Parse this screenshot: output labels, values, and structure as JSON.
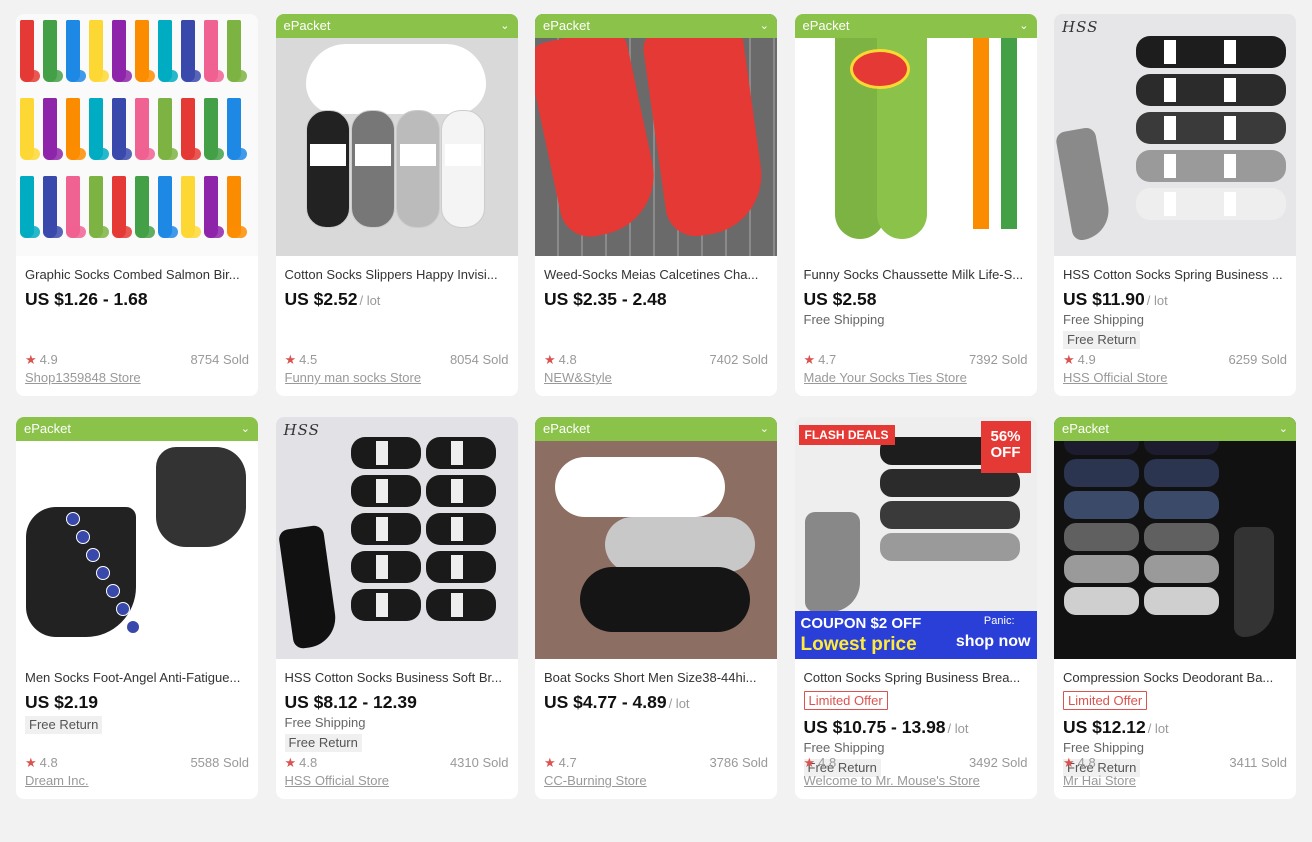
{
  "products": [
    {
      "title": "Graphic Socks Combed Salmon Bir...",
      "price": "US $1.26 - 1.68",
      "per": "",
      "shipping": "",
      "free_return": "",
      "limited": "",
      "rating": "4.9",
      "sold": "8754 Sold",
      "store": "Shop1359848 Store",
      "badge": "",
      "img_theme": "colorful"
    },
    {
      "title": "Cotton Socks Slippers Happy Invisi...",
      "price": "US $2.52",
      "per": "/ lot",
      "shipping": "",
      "free_return": "",
      "limited": "",
      "rating": "4.5",
      "sold": "8054 Sold",
      "store": "Funny man socks Store",
      "badge": "ePacket",
      "img_theme": "noshow"
    },
    {
      "title": "Weed-Socks Meias Calcetines Cha...",
      "price": "US $2.35 - 2.48",
      "per": "",
      "shipping": "",
      "free_return": "",
      "limited": "",
      "rating": "4.8",
      "sold": "7402 Sold",
      "store": "NEW&Style",
      "badge": "ePacket",
      "img_theme": "red"
    },
    {
      "title": "Funny Socks Chaussette Milk Life-S...",
      "price": "US $2.58",
      "per": "",
      "shipping": "Free Shipping",
      "free_return": "",
      "limited": "",
      "rating": "4.7",
      "sold": "7392 Sold",
      "store": "Made Your Socks Ties Store",
      "badge": "ePacket",
      "img_theme": "chips"
    },
    {
      "title": "HSS Cotton Socks Spring Business ...",
      "price": "US $11.90",
      "per": "/ lot",
      "shipping": "Free Shipping",
      "free_return": "Free Return",
      "limited": "",
      "rating": "4.9",
      "sold": "6259 Sold",
      "store": "HSS Official Store",
      "badge": "HSS",
      "img_theme": "boxgray"
    },
    {
      "title": "Men Socks Foot-Angel Anti-Fatigue...",
      "price": "US $2.19",
      "per": "",
      "shipping": "",
      "free_return": "Free Return",
      "limited": "",
      "rating": "4.8",
      "sold": "5588 Sold",
      "store": "Dream Inc.",
      "badge": "ePacket",
      "img_theme": "ankle"
    },
    {
      "title": "HSS Cotton Socks Business Soft Br...",
      "price": "US $8.12 - 12.39",
      "per": "",
      "shipping": "Free Shipping",
      "free_return": "Free Return",
      "limited": "",
      "rating": "4.8",
      "sold": "4310 Sold",
      "store": "HSS Official Store",
      "badge": "HSS",
      "img_theme": "boxblack"
    },
    {
      "title": "Boat Socks Short Men Size38-44hi...",
      "price": "US $4.77 - 4.89",
      "per": "/ lot",
      "shipping": "",
      "free_return": "",
      "limited": "",
      "rating": "4.7",
      "sold": "3786 Sold",
      "store": "CC-Burning Store",
      "badge": "ePacket",
      "img_theme": "boat"
    },
    {
      "title": "Cotton Socks Spring Business Brea...",
      "price": "US $10.75 - 13.98",
      "per": "/ lot",
      "shipping": "Free Shipping",
      "free_return": "Free Return",
      "limited": "Limited Offer",
      "rating": "4.8",
      "sold": "3492 Sold",
      "store": "Welcome to Mr. Mouse's Store",
      "badge": "",
      "img_theme": "flash"
    },
    {
      "title": "Compression Socks Deodorant Ba...",
      "price": "US $12.12",
      "per": "/ lot",
      "shipping": "Free Shipping",
      "free_return": "Free Return",
      "limited": "Limited Offer",
      "rating": "4.8",
      "sold": "3411 Sold",
      "store": "Mr Hai Store",
      "badge": "ePacket",
      "img_theme": "compress"
    }
  ],
  "flash": {
    "deals": "FLASH DEALS",
    "off_pct": "56%",
    "off_word": "OFF",
    "coupon": "COUPON $2 OFF",
    "lowest": "Lowest price",
    "shop": "shop now",
    "panic": "Panic:"
  },
  "colors": {
    "epacket": "#8bc34a",
    "star": "#d9534f",
    "limited": "#d9534f"
  }
}
